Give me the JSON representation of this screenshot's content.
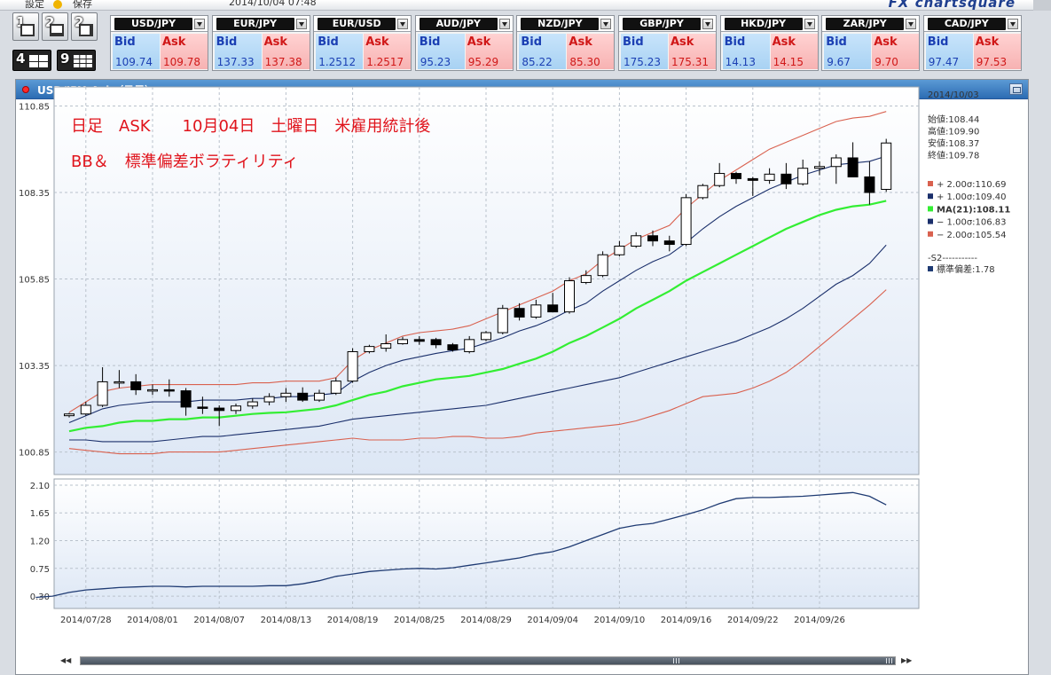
{
  "toolbar": {
    "setting_label": "設定",
    "save_label": "保存",
    "datetime": "2014/10/04 07:48",
    "brand": "FX chartsquare"
  },
  "layouts": [
    {
      "num": "1",
      "name": "layout-1"
    },
    {
      "num": "2",
      "name": "layout-2"
    },
    {
      "num": "2",
      "name": "layout-2b"
    },
    {
      "num": "4",
      "name": "layout-4"
    },
    {
      "num": "9",
      "name": "layout-9"
    }
  ],
  "rates": [
    {
      "pair": "USD/JPY",
      "bid": "109.74",
      "ask": "109.78"
    },
    {
      "pair": "EUR/JPY",
      "bid": "137.33",
      "ask": "137.38"
    },
    {
      "pair": "EUR/USD",
      "bid": "1.2512",
      "ask": "1.2517"
    },
    {
      "pair": "AUD/JPY",
      "bid": "95.23",
      "ask": "95.29"
    },
    {
      "pair": "NZD/JPY",
      "bid": "85.22",
      "ask": "85.30"
    },
    {
      "pair": "GBP/JPY",
      "bid": "175.23",
      "ask": "175.31"
    },
    {
      "pair": "HKD/JPY",
      "bid": "14.13",
      "ask": "14.15"
    },
    {
      "pair": "ZAR/JPY",
      "bid": "9.67",
      "ask": "9.70"
    },
    {
      "pair": "CAD/JPY",
      "bid": "97.47",
      "ask": "97.53"
    }
  ],
  "rate_labels": {
    "bid": "Bid",
    "ask": "Ask"
  },
  "chart_window": {
    "title": "USD/JPY_Ask（日足）"
  },
  "colors": {
    "candle_up": "#ffffff",
    "candle_down": "#000000",
    "ma": "#33ee33",
    "band1": "#1a2f6b",
    "band2": "#d9614f",
    "sd": "#1f3b73",
    "bg_top": "#ffffff",
    "bg_bottom": "#dde7f5"
  },
  "chart_data": {
    "type": "candlestick",
    "annotations": [
      "日足　ASK　　10月04日　土曜日　米雇用統計後",
      "BB＆　標準偏差ボラティリティ"
    ],
    "main_panel": {
      "ylim": [
        100.2,
        111.4
      ],
      "y_ticks": [
        "110.85",
        "108.35",
        "105.85",
        "103.35",
        "100.85"
      ],
      "y_tick_values": [
        110.85,
        108.35,
        105.85,
        103.35,
        100.85
      ]
    },
    "sub_panel": {
      "ylim": [
        0.1,
        2.2
      ],
      "y_ticks": [
        "2.10",
        "1.65",
        "1.20",
        "0.75",
        "0.30"
      ],
      "y_tick_values": [
        2.1,
        1.65,
        1.2,
        0.75,
        0.3
      ]
    },
    "x_ticks": [
      "2014/07/28",
      "2014/08/01",
      "2014/08/07",
      "2014/08/13",
      "2014/08/19",
      "2014/08/25",
      "2014/08/29",
      "2014/09/04",
      "2014/09/10",
      "2014/09/16",
      "2014/09/22",
      "2014/09/26"
    ],
    "x_tick_index": [
      1,
      5,
      9,
      13,
      17,
      21,
      25,
      29,
      33,
      37,
      41,
      45
    ],
    "candles": [
      [
        101.9,
        101.98,
        101.85,
        101.95
      ],
      [
        101.95,
        102.3,
        101.9,
        102.2
      ],
      [
        102.2,
        103.3,
        102.15,
        102.88
      ],
      [
        102.88,
        103.22,
        102.7,
        102.88
      ],
      [
        102.88,
        103.1,
        102.5,
        102.65
      ],
      [
        102.65,
        102.8,
        102.5,
        102.65
      ],
      [
        102.65,
        102.95,
        102.45,
        102.62
      ],
      [
        102.62,
        102.7,
        101.9,
        102.15
      ],
      [
        102.15,
        102.45,
        101.95,
        102.12
      ],
      [
        102.12,
        102.2,
        101.6,
        102.05
      ],
      [
        102.05,
        102.25,
        101.95,
        102.18
      ],
      [
        102.18,
        102.4,
        102.1,
        102.3
      ],
      [
        102.3,
        102.55,
        102.2,
        102.45
      ],
      [
        102.45,
        102.7,
        102.3,
        102.55
      ],
      [
        102.55,
        102.72,
        102.3,
        102.35
      ],
      [
        102.35,
        102.65,
        102.3,
        102.55
      ],
      [
        102.55,
        103.0,
        102.5,
        102.9
      ],
      [
        102.9,
        103.85,
        102.85,
        103.75
      ],
      [
        103.75,
        103.95,
        103.7,
        103.9
      ],
      [
        103.85,
        104.25,
        103.75,
        103.98
      ],
      [
        103.98,
        104.18,
        103.95,
        104.1
      ],
      [
        104.1,
        104.2,
        103.95,
        104.05
      ],
      [
        104.1,
        104.15,
        103.85,
        103.95
      ],
      [
        103.95,
        104.0,
        103.75,
        103.8
      ],
      [
        103.75,
        104.2,
        103.7,
        104.1
      ],
      [
        104.1,
        104.35,
        104.05,
        104.3
      ],
      [
        104.3,
        105.1,
        104.25,
        105.0
      ],
      [
        105.0,
        105.15,
        104.65,
        104.75
      ],
      [
        104.75,
        105.25,
        104.7,
        105.1
      ],
      [
        105.1,
        105.45,
        104.9,
        104.9
      ],
      [
        104.9,
        105.9,
        104.85,
        105.8
      ],
      [
        105.75,
        106.1,
        105.7,
        105.95
      ],
      [
        105.95,
        106.65,
        105.9,
        106.55
      ],
      [
        106.55,
        106.95,
        106.5,
        106.8
      ],
      [
        106.8,
        107.2,
        106.75,
        107.1
      ],
      [
        107.1,
        107.25,
        106.8,
        106.95
      ],
      [
        106.95,
        107.1,
        106.65,
        106.85
      ],
      [
        106.85,
        108.3,
        106.8,
        108.2
      ],
      [
        108.2,
        108.6,
        108.15,
        108.55
      ],
      [
        108.55,
        109.2,
        108.5,
        108.9
      ],
      [
        108.9,
        108.95,
        108.6,
        108.75
      ],
      [
        108.75,
        108.8,
        108.25,
        108.7
      ],
      [
        108.7,
        109.05,
        108.6,
        108.88
      ],
      [
        108.88,
        109.2,
        108.45,
        108.6
      ],
      [
        108.6,
        109.3,
        108.55,
        109.05
      ],
      [
        109.05,
        109.25,
        108.85,
        109.1
      ],
      [
        109.1,
        109.45,
        108.6,
        109.35
      ],
      [
        109.35,
        109.8,
        108.8,
        108.8
      ],
      [
        108.8,
        109.25,
        108.0,
        108.35
      ],
      [
        108.44,
        109.9,
        108.37,
        109.78
      ]
    ],
    "series": [
      {
        "name": "+2.00σ",
        "color": "#d9614f",
        "values": [
          102.0,
          102.3,
          102.6,
          102.7,
          102.75,
          102.8,
          102.8,
          102.8,
          102.8,
          102.8,
          102.8,
          102.85,
          102.85,
          102.9,
          102.9,
          102.9,
          103.0,
          103.5,
          103.8,
          104.0,
          104.2,
          104.3,
          104.35,
          104.4,
          104.5,
          104.7,
          104.9,
          105.1,
          105.3,
          105.5,
          105.8,
          106.0,
          106.4,
          106.7,
          107.0,
          107.2,
          107.4,
          107.9,
          108.3,
          108.7,
          109.0,
          109.3,
          109.6,
          109.8,
          110.0,
          110.2,
          110.4,
          110.5,
          110.55,
          110.69
        ]
      },
      {
        "name": "+1.00σ",
        "color": "#1a2f6b",
        "values": [
          101.7,
          101.9,
          102.1,
          102.2,
          102.25,
          102.3,
          102.3,
          102.3,
          102.35,
          102.35,
          102.35,
          102.4,
          102.4,
          102.45,
          102.45,
          102.5,
          102.55,
          102.9,
          103.15,
          103.35,
          103.5,
          103.6,
          103.7,
          103.78,
          103.85,
          104.0,
          104.15,
          104.35,
          104.5,
          104.7,
          104.95,
          105.15,
          105.5,
          105.8,
          106.1,
          106.35,
          106.55,
          106.9,
          107.3,
          107.65,
          107.95,
          108.2,
          108.45,
          108.65,
          108.85,
          109.0,
          109.15,
          109.2,
          109.25,
          109.4
        ]
      },
      {
        "name": "MA(21)",
        "color": "#33ee33",
        "values": [
          101.45,
          101.55,
          101.6,
          101.7,
          101.75,
          101.75,
          101.8,
          101.8,
          101.85,
          101.85,
          101.9,
          101.95,
          101.98,
          102.0,
          102.05,
          102.1,
          102.2,
          102.35,
          102.5,
          102.6,
          102.75,
          102.85,
          102.95,
          103.0,
          103.05,
          103.15,
          103.25,
          103.4,
          103.55,
          103.75,
          104.0,
          104.2,
          104.45,
          104.7,
          105.0,
          105.25,
          105.5,
          105.8,
          106.05,
          106.3,
          106.55,
          106.8,
          107.05,
          107.3,
          107.5,
          107.7,
          107.85,
          107.95,
          108.0,
          108.11
        ]
      },
      {
        "name": "−1.00σ",
        "color": "#1a2f6b",
        "values": [
          101.2,
          101.2,
          101.15,
          101.15,
          101.15,
          101.15,
          101.2,
          101.25,
          101.3,
          101.3,
          101.35,
          101.4,
          101.45,
          101.5,
          101.55,
          101.6,
          101.7,
          101.8,
          101.85,
          101.9,
          101.95,
          102.0,
          102.05,
          102.1,
          102.15,
          102.2,
          102.3,
          102.4,
          102.5,
          102.6,
          102.7,
          102.8,
          102.9,
          103.0,
          103.15,
          103.3,
          103.45,
          103.6,
          103.75,
          103.9,
          104.05,
          104.25,
          104.45,
          104.7,
          105.0,
          105.35,
          105.7,
          105.95,
          106.3,
          106.83
        ]
      },
      {
        "name": "−2.00σ",
        "color": "#d9614f",
        "values": [
          100.95,
          100.9,
          100.85,
          100.8,
          100.8,
          100.8,
          100.85,
          100.85,
          100.85,
          100.85,
          100.9,
          100.95,
          101.0,
          101.05,
          101.1,
          101.15,
          101.2,
          101.25,
          101.2,
          101.2,
          101.2,
          101.25,
          101.25,
          101.3,
          101.3,
          101.25,
          101.25,
          101.3,
          101.4,
          101.45,
          101.5,
          101.55,
          101.6,
          101.65,
          101.75,
          101.9,
          102.05,
          102.25,
          102.45,
          102.5,
          102.55,
          102.7,
          102.9,
          103.15,
          103.5,
          103.9,
          104.3,
          104.7,
          105.1,
          105.54
        ]
      }
    ],
    "sd_series": {
      "name": "標準偏差",
      "color": "#1f3b73",
      "values": [
        0.28,
        0.3,
        0.36,
        0.4,
        0.42,
        0.44,
        0.45,
        0.46,
        0.46,
        0.45,
        0.46,
        0.46,
        0.46,
        0.46,
        0.47,
        0.47,
        0.5,
        0.55,
        0.62,
        0.66,
        0.7,
        0.72,
        0.74,
        0.75,
        0.74,
        0.76,
        0.8,
        0.84,
        0.88,
        0.92,
        0.98,
        1.02,
        1.1,
        1.2,
        1.3,
        1.4,
        1.45,
        1.48,
        1.55,
        1.62,
        1.7,
        1.8,
        1.88,
        1.9,
        1.9,
        1.91,
        1.92,
        1.94,
        1.96,
        1.98,
        1.92,
        1.78
      ]
    },
    "info": {
      "date": "2014/10/03",
      "ohlc": [
        "始値:108.44",
        "高値:109.90",
        "安値:108.37",
        "終値:109.78"
      ],
      "legend": [
        {
          "label": "+ 2.00σ:110.69",
          "color": "#d9614f",
          "bold": false
        },
        {
          "label": "+ 1.00σ:109.40",
          "color": "#1a2f6b",
          "bold": false
        },
        {
          "label": "MA(21):108.11",
          "color": "#33ee33",
          "bold": true
        },
        {
          "label": "− 1.00σ:106.83",
          "color": "#1a2f6b",
          "bold": false
        },
        {
          "label": "− 2.00σ:105.54",
          "color": "#d9614f",
          "bold": false
        }
      ],
      "sub_title": "-S2-----------",
      "sub_legend": {
        "label": "標準偏差:1.78",
        "color": "#1f3b73"
      }
    }
  }
}
